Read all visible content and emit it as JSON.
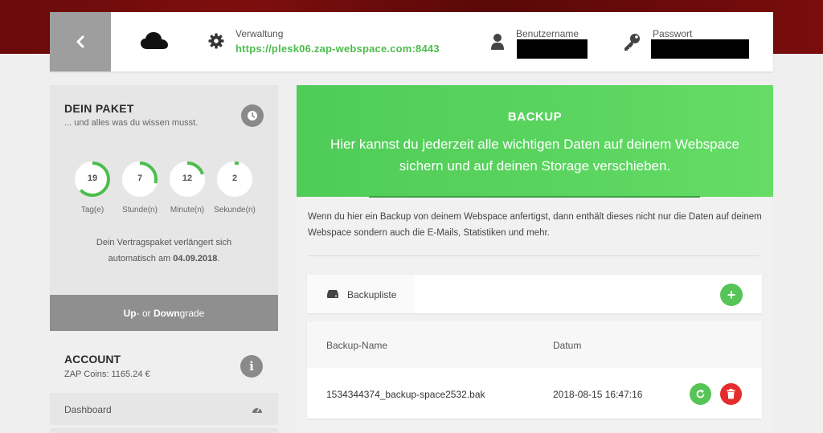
{
  "header": {
    "admin_label": "Verwaltung",
    "admin_url": "https://plesk06.zap-webspace.com:8443",
    "username_label": "Benutzername",
    "password_label": "Passwort"
  },
  "package": {
    "title": "DEIN PAKET",
    "subtitle": "... und alles was du wissen musst.",
    "countdown": [
      {
        "value": "19",
        "label": "Tag(e)",
        "fraction": 0.63
      },
      {
        "value": "7",
        "label": "Stunde(n)",
        "fraction": 0.29
      },
      {
        "value": "12",
        "label": "Minute(n)",
        "fraction": 0.2
      },
      {
        "value": "2",
        "label": "Sekunde(n)",
        "fraction": 0.04
      }
    ],
    "renew_line1": "Dein Vertragspaket verlängert sich",
    "renew_line2_prefix": "automatisch am ",
    "renew_date": "04.09.2018",
    "renew_suffix": ".",
    "upgrade_up": "Up",
    "upgrade_mid": "- or ",
    "upgrade_down": "Down",
    "upgrade_end": "grade"
  },
  "account": {
    "title": "ACCOUNT",
    "coins": "ZAP Coins: 1165.24 €",
    "dashboard_label": "Dashboard"
  },
  "backup": {
    "title": "BACKUP",
    "hero_line1": "Hier kannst du jederzeit alle wichtigen Daten auf deinem Webspace",
    "hero_line2": "sichern und auf deinen Storage verschieben.",
    "intro": "Wenn du hier ein Backup von deinem Webspace anfertigst, dann enthält dieses nicht nur die Daten auf deinem Webspace sondern auch die E-Mails, Statistiken und mehr.",
    "list_label": "Backupliste",
    "add_symbol": "+",
    "columns": [
      "Backup-Name",
      "Datum"
    ],
    "rows": [
      {
        "name": "1534344374_backup-space2532.bak",
        "date": "2018-08-15 16:47:16"
      }
    ]
  },
  "colors": {
    "accent_green": "#4dbd4d",
    "danger_red": "#e52b2b",
    "header_band": "#6a0a0a"
  }
}
